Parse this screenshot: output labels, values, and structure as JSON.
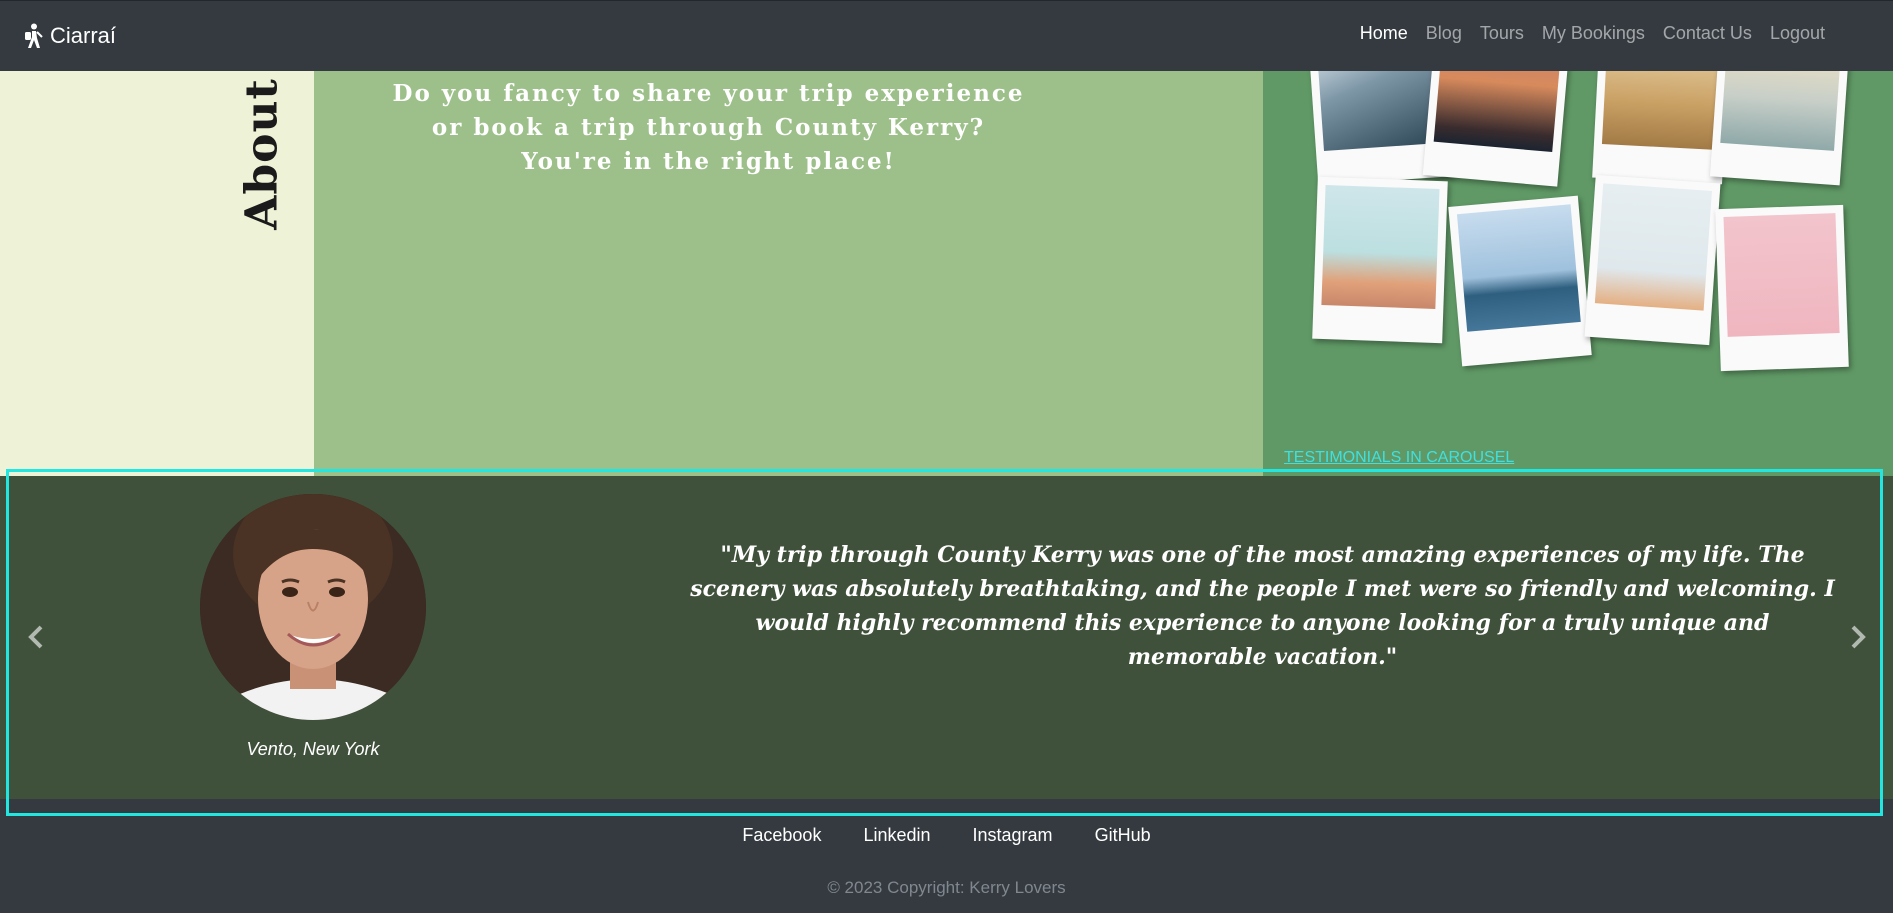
{
  "navbar": {
    "brand": "Ciarraí",
    "links": [
      {
        "label": "Home",
        "active": true
      },
      {
        "label": "Blog"
      },
      {
        "label": "Tours"
      },
      {
        "label": "My Bookings"
      },
      {
        "label": "Contact Us"
      },
      {
        "label": "Logout"
      }
    ]
  },
  "about": {
    "title": "About",
    "lines": [
      "Do you fancy to share your trip experience",
      "or book a trip through County Kerry?",
      "You're in the right place!"
    ]
  },
  "testimonials": {
    "label": "TESTIMONIALS IN CAROUSEL",
    "quote": "\"My trip through County Kerry was one of the most amazing experiences of my life. The scenery was absolutely breathtaking, and the people I met were so friendly and welcoming. I would highly recommend this experience to anyone looking for a truly unique and memorable vacation.\"",
    "author": "Vento, New York",
    "highlight_color": "#22e6e0"
  },
  "footer": {
    "links": [
      "Facebook",
      "Linkedin",
      "Instagram",
      "GitHub"
    ],
    "copyright": "© 2023 Copyright: Kerry Lovers"
  },
  "colors": {
    "navbar": "#343a40",
    "about_left": "#eef2d6",
    "about_mid": "#9dc08b",
    "about_right": "#609966",
    "carousel": "#40513b"
  }
}
